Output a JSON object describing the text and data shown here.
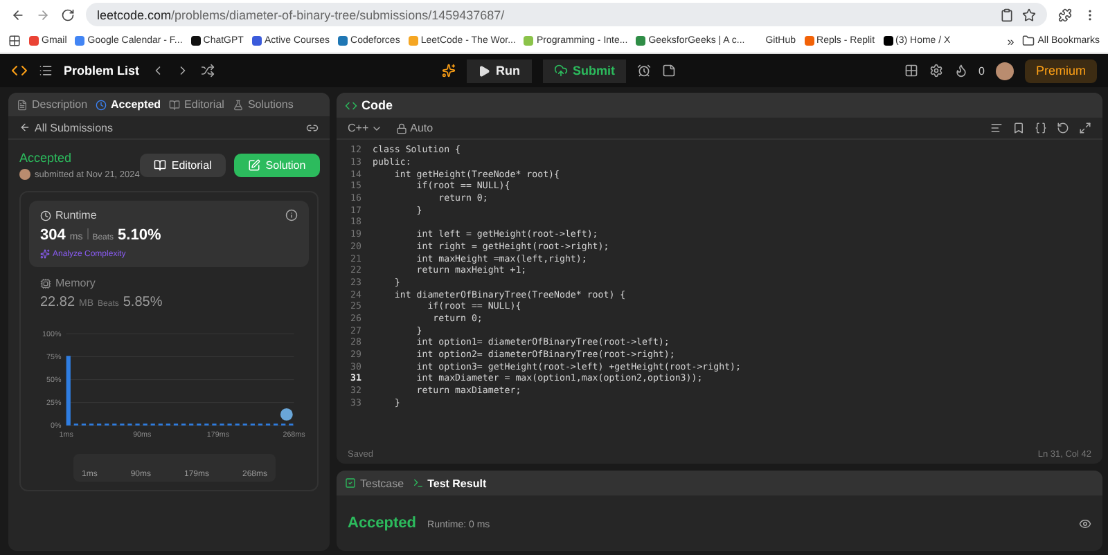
{
  "browser": {
    "url_host": "leetcode.com",
    "url_path": "/problems/diameter-of-binary-tree/submissions/1459437687/",
    "bookmarks": [
      "Gmail",
      "Google Calendar - F...",
      "ChatGPT",
      "Active Courses",
      "Codeforces",
      "LeetCode - The Wor...",
      "Programming - Inte...",
      "GeeksforGeeks | A c...",
      "GitHub",
      "Repls - Replit",
      "(3) Home / X"
    ],
    "more": "»",
    "all_bookmarks": "All Bookmarks"
  },
  "nav": {
    "problem_list": "Problem List",
    "run": "Run",
    "submit": "Submit",
    "streak": "0",
    "premium": "Premium"
  },
  "left": {
    "tabs": [
      {
        "label": "Description",
        "selected": false
      },
      {
        "label": "Accepted",
        "selected": true
      },
      {
        "label": "Editorial",
        "selected": false
      },
      {
        "label": "Solutions",
        "selected": false
      }
    ],
    "back": "All Submissions",
    "status": "Accepted",
    "submitted": "submitted at Nov 21, 2024",
    "editorial_button": "Editorial",
    "solution_button": "Solution",
    "runtime": {
      "title": "Runtime",
      "value": "304",
      "unit": "ms",
      "beats_label": "Beats",
      "beats": "5.10%",
      "analyze": "Analyze Complexity"
    },
    "memory": {
      "title": "Memory",
      "value": "22.82",
      "unit": "MB",
      "beats_label": "Beats",
      "beats": "5.85%"
    },
    "chart_data": {
      "type": "bar",
      "grid": true,
      "x": [
        1,
        10,
        19,
        28,
        37,
        46,
        55,
        64,
        73,
        82,
        91,
        100,
        109,
        118,
        127,
        136,
        145,
        154,
        163,
        172,
        181,
        190,
        199,
        208,
        217,
        226,
        235,
        244,
        253,
        262
      ],
      "series": [
        {
          "color": "#2f7de1",
          "values": [
            76,
            2,
            2,
            2,
            2,
            2,
            2,
            2,
            2,
            2,
            2,
            2,
            2,
            2,
            2,
            2,
            2,
            2,
            2,
            2,
            2,
            2,
            2,
            2,
            2,
            2,
            2,
            2,
            2,
            2
          ]
        }
      ],
      "xlim": [
        1,
        268
      ],
      "ylim": [
        0,
        100
      ],
      "xticks": [
        {
          "value": 1,
          "label": "1ms"
        },
        {
          "value": 90,
          "label": "90ms"
        },
        {
          "value": 179,
          "label": "179ms"
        },
        {
          "value": 268,
          "label": "268ms"
        }
      ],
      "yticks": [
        {
          "value": 0,
          "label": "0%"
        },
        {
          "value": 25,
          "label": "25%"
        },
        {
          "value": 50,
          "label": "50%"
        },
        {
          "value": 75,
          "label": "75%"
        },
        {
          "value": 100,
          "label": "100%"
        }
      ]
    },
    "brush_labels": [
      "1ms",
      "90ms",
      "179ms",
      "268ms"
    ]
  },
  "code": {
    "title": "Code",
    "language": "C++",
    "mode": "Auto",
    "lines": [
      {
        "n": "12",
        "text": "class Solution {",
        "current": false
      },
      {
        "n": "13",
        "text": "public:",
        "current": false
      },
      {
        "n": "14",
        "text": "    int getHeight(TreeNode* root){",
        "current": false
      },
      {
        "n": "15",
        "text": "        if(root == NULL){",
        "current": false
      },
      {
        "n": "16",
        "text": "            return 0;",
        "current": false
      },
      {
        "n": "17",
        "text": "        }",
        "current": false
      },
      {
        "n": "18",
        "current": false
      },
      {
        "n": "19",
        "text": "        int left = getHeight(root->left);",
        "current": false
      },
      {
        "n": "20",
        "text": "        int right = getHeight(root->right);",
        "current": false
      },
      {
        "n": "21",
        "text": "        int maxHeight =max(left,right);",
        "current": false
      },
      {
        "n": "22",
        "text": "        return maxHeight +1;",
        "current": false
      },
      {
        "n": "23",
        "text": "    }",
        "current": false
      },
      {
        "n": "24",
        "text": "    int diameterOfBinaryTree(TreeNode* root) {",
        "current": false
      },
      {
        "n": "25",
        "text": "          if(root == NULL){",
        "current": false
      },
      {
        "n": "26",
        "text": "           return 0;",
        "current": false
      },
      {
        "n": "27",
        "text": "        }",
        "current": false
      },
      {
        "n": "28",
        "text": "        int option1= diameterOfBinaryTree(root->left);",
        "current": false
      },
      {
        "n": "29",
        "text": "        int option2= diameterOfBinaryTree(root->right);",
        "current": false
      },
      {
        "n": "30",
        "text": "        int option3= getHeight(root->left) +getHeight(root->right);",
        "current": false
      },
      {
        "n": "31",
        "text": "        int maxDiameter = max(option1,max(option2,option3));",
        "current": true
      },
      {
        "n": "32",
        "text": "        return maxDiameter;",
        "current": false
      },
      {
        "n": "33",
        "text": "    }",
        "current": false
      }
    ],
    "saved": "Saved",
    "cursor": "Ln 31, Col 42"
  },
  "bottom": {
    "tabs": [
      {
        "label": "Testcase",
        "selected": false
      },
      {
        "label": "Test Result",
        "selected": true
      }
    ],
    "status": "Accepted",
    "runtime": "Runtime: 0 ms"
  }
}
